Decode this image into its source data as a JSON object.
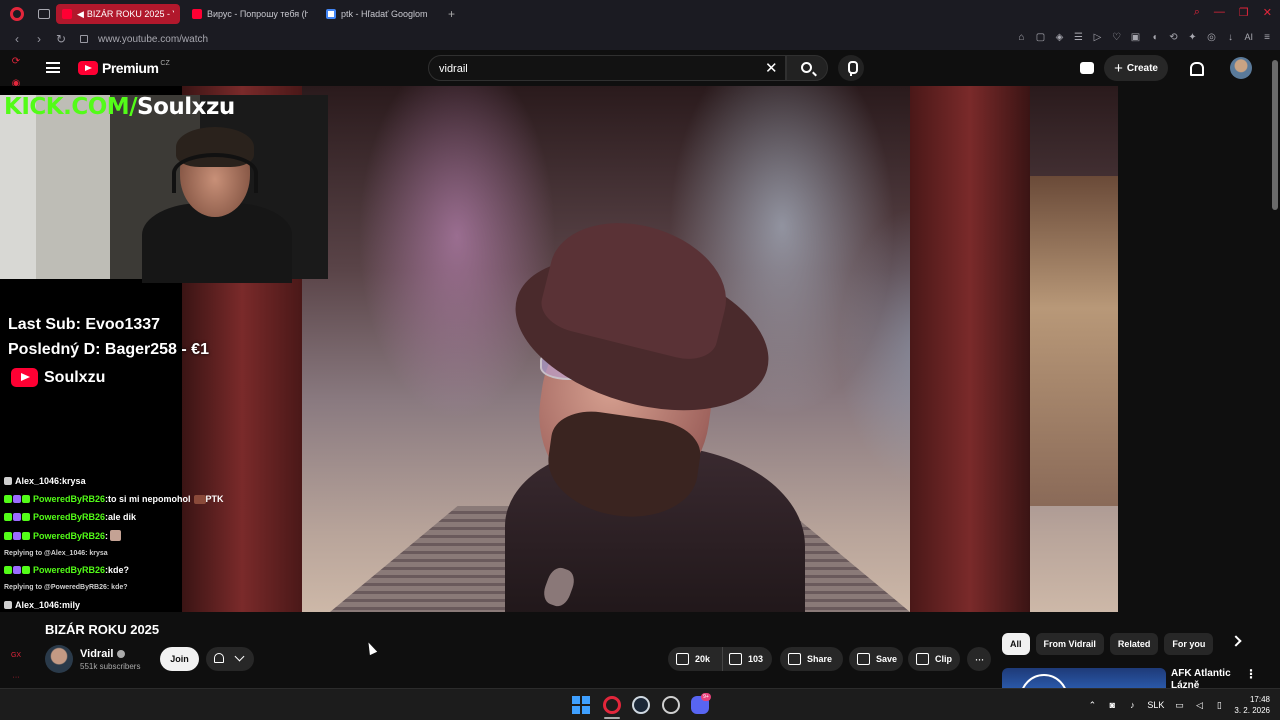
{
  "browser": {
    "tabs": [
      {
        "title": "BIZÁR ROKU 2025 - Yo",
        "active": true,
        "favicon": "youtube-icon",
        "audio": true
      },
      {
        "title": "Вирус - Попрошу тебя (h",
        "active": false,
        "favicon": "youtube-icon"
      },
      {
        "title": "ptk - Hľadať Googlom",
        "active": false,
        "favicon": "google-icon"
      }
    ],
    "url": "www.youtube.com/watch",
    "extensions_ai_label": "AI",
    "accent_color": "#e2263b"
  },
  "youtube": {
    "logo_text": "Premium",
    "logo_region": "CZ",
    "search": {
      "value": "vidrail"
    },
    "create_label": "Create"
  },
  "stream_overlay": {
    "kick_prefix": "KICK.COM/",
    "kick_name": "Soulxzu",
    "last_sub": "Last Sub: Evoo1337",
    "last_donation": "Posledný D: Bager258 - €1",
    "youtube_name": "Soulxzu",
    "chat": [
      {
        "type": "msg",
        "user": "Alex_1046",
        "text": " krysa",
        "badges": [
          "b1"
        ],
        "user_color": "white"
      },
      {
        "type": "msg",
        "user": "PoweredByRB26",
        "text": " to si mi nepomohol",
        "suffix": " PTK",
        "emote": true,
        "badges": [
          "b2",
          "b3",
          "b2"
        ],
        "user_color": "green"
      },
      {
        "type": "msg",
        "user": "PoweredByRB26",
        "text": " ale dik",
        "badges": [
          "b2",
          "b3",
          "b2"
        ],
        "user_color": "green"
      },
      {
        "type": "msg",
        "user": "PoweredByRB26",
        "text": "",
        "emote2": true,
        "badges": [
          "b2",
          "b3",
          "b2"
        ],
        "user_color": "green"
      },
      {
        "type": "reply",
        "text": "Replying to @Alex_1046: krysa"
      },
      {
        "type": "msg",
        "user": "PoweredByRB26",
        "text": " kde?",
        "badges": [
          "b2",
          "b3",
          "b2"
        ],
        "user_color": "green"
      },
      {
        "type": "reply",
        "text": "Replying to @PoweredByRB26: kde?"
      },
      {
        "type": "msg",
        "user": "Alex_1046",
        "text": " mily",
        "badges": [
          "b1"
        ],
        "user_color": "white"
      }
    ]
  },
  "video": {
    "title": "BIZÁR ROKU 2025",
    "channel": {
      "name": "Vidrail",
      "subscribers": "551k subscribers",
      "verified": true
    },
    "join_label": "Join",
    "likes": "20k",
    "dislikes": "103",
    "share_label": "Share",
    "save_label": "Save",
    "clip_label": "Clip"
  },
  "related": {
    "chips": [
      "All",
      "From Vidrail",
      "Related",
      "For you"
    ],
    "active_chip": "All",
    "first_item_title": "AFK Atlantic Lázně"
  },
  "taskbar": {
    "discord_badge": "9+",
    "language": "SLK",
    "time": "17:48",
    "date": "3. 2. 2026"
  }
}
